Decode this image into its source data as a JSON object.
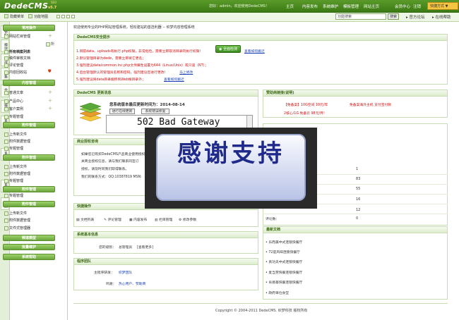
{
  "header": {
    "logo": "DedeCMS",
    "version": "v5.7",
    "tagline": "SEO",
    "user_text": "您好：admin，欢迎使用DedeCMS！",
    "nav": [
      "主页",
      "内容发布",
      "系统维护",
      "模板管理",
      "网站主页",
      "会员中心",
      "注销"
    ],
    "quick_btn": "快捷方式 ▼"
  },
  "subheader": {
    "hide_menu": "隐藏菜单",
    "func_map": "功能地图",
    "search_placeholder": "功能搜索",
    "search_btn": "搜索",
    "forum": "官方论坛",
    "help": "在线帮助"
  },
  "vtabs": [
    "核心",
    "模块",
    "生成",
    "采集",
    "会员",
    "模板",
    "系统",
    "系统",
    "系统",
    "系统"
  ],
  "menu": {
    "sections": [
      {
        "title": "常用操作",
        "items": [
          "网站栏目管理",
          "所有档案列表",
          "等我发布的文档",
          "稿件审核文档",
          "评论管理",
          "内容回收站"
        ]
      },
      {
        "title": "内容管理",
        "items": [
          "普通文章",
          "产品中心",
          "客户案例",
          "专题管理"
        ]
      },
      {
        "title": "附件管理",
        "items": [
          "上传新文件",
          "附件数据管理",
          "专题管理"
        ]
      },
      {
        "title": "附件管理",
        "items": [
          "上传新文件",
          "附件数据管理",
          "专题管理"
        ]
      },
      {
        "title": "附件管理",
        "items": [
          "专题管理"
        ]
      },
      {
        "title": "附件管理",
        "items": [
          "上传新文件",
          "附件数据管理",
          "文件式管理器"
        ]
      },
      {
        "title": "频道模型",
        "items": []
      },
      {
        "title": "批量维护",
        "items": []
      },
      {
        "title": "系统帮助",
        "items": []
      }
    ],
    "extra": "所"
  },
  "main": {
    "welcome": "欢迎使用专业的PHP网站管理系统，轻松建站的首选利器 -- 织梦内容管理系统",
    "tips": {
      "title": "DedeCMS安全提示",
      "lines": [
        "1.目前data、uploads有执行.php权限，非常危险，需要立即取消目录的执行权限！",
        "2.默认管理目录为dede，需要立即将它更名；",
        "3.强烈建议data/common.inc.php文件属性设置为644（Linux/Unix）或只读（NT）；",
        "4.后台管理默认的管理员名称和密码，强烈建议您进行更改！",
        "5.强烈建议将data目录搬移到Web根目录外；"
      ],
      "check_btn": "全面检测",
      "howto": "查看如何搬迁",
      "modify": "马上修改",
      "move": "查看如何搬迁"
    },
    "update": {
      "title": "DedeCMS 更新消息",
      "check_text": "您系统版本最后更新时间为：2014-08-14",
      "btn_update": "进行在线更新",
      "btn_fix": "系统错误修复",
      "error": "502 Bad Gateway"
    },
    "sponsor": {
      "title": "赞助商链接(说明)",
      "line1": "【免备案】10G空间 10元/年",
      "line1b": "免备案海外主机 支付宝付款",
      "line2": "2核心/1G 免备云 98元/月！"
    },
    "license": {
      "title": "商业授权咨询",
      "lines": [
        "如果您已购买DedeCMS产品商业使用授权，",
        "关商业授权信息，请与我们联系同签订",
        "授权，请及时同我们取得联系。",
        "我们的联系方式：QQ:10387819 MSN:"
      ]
    },
    "stats": {
      "values": [
        "1",
        "83",
        "55",
        "16",
        "12",
        "0"
      ],
      "last_label": "评论数：",
      "last_value": "0"
    },
    "quick": {
      "title": "快捷操作",
      "items": [
        "文档列表",
        "评论管理",
        "内容发布",
        "栏目管理",
        "修改参数"
      ]
    },
    "basic": {
      "title": "系统基本信息",
      "label": "您的级别：",
      "value": "总管理员",
      "more": "[查看更多]"
    },
    "team": {
      "title": "程序团队",
      "lead_label": "主程序研发：",
      "lead_value": "织梦团队",
      "thanks_label": "鸣谢：",
      "thanks_value": "热心用户、赞助商"
    },
    "news": {
      "title": "最新文档",
      "items": [
        "乐而美中式连锁快餐厅",
        "72度风味连锁快餐厅",
        "真功夫中式连锁快餐厅",
        "麦当劳快餐连锁快餐厅",
        "肯德基快餐连锁快餐厅",
        "政府单位食堂"
      ]
    },
    "overlay": "感谢支持",
    "footer": "Copyright © 2004-2011 DedeCMS. 织梦科技 版权所有"
  }
}
